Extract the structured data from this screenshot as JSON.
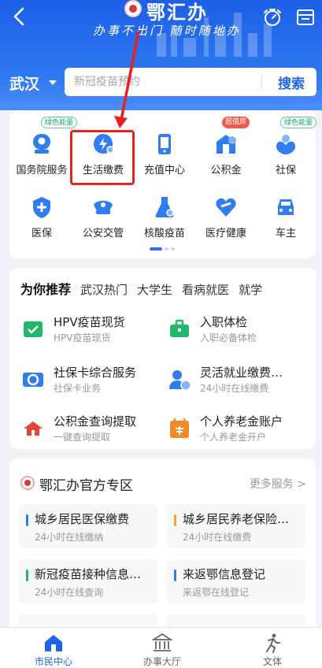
{
  "header": {
    "app_title": "鄂汇办",
    "slogan": "办事不出门 随时随地办",
    "city": "武汉",
    "search_placeholder": "新冠疫苗预约",
    "search_button": "搜索",
    "colors": {
      "primary": "#1f63e6",
      "highlight_box": "#e8211c"
    }
  },
  "services": [
    {
      "label": "国务院服务",
      "icon": "gov-service-icon",
      "tag": "绿色能量",
      "tag_style": "green"
    },
    {
      "label": "生活缴费",
      "icon": "lightning-bill-icon",
      "tag": "",
      "tag_style": ""
    },
    {
      "label": "充值中心",
      "icon": "phone-recharge-icon",
      "tag": "",
      "tag_style": ""
    },
    {
      "label": "公积金",
      "icon": "housing-fund-icon",
      "tag": "超值房",
      "tag_style": "red"
    },
    {
      "label": "社保",
      "icon": "social-security-icon",
      "tag": "绿色能量",
      "tag_style": "green"
    },
    {
      "label": "医保",
      "icon": "medical-insurance-icon"
    },
    {
      "label": "公安交管",
      "icon": "police-cap-icon"
    },
    {
      "label": "核酸疫苗",
      "icon": "flask-icon"
    },
    {
      "label": "医疗健康",
      "icon": "heart-health-icon"
    },
    {
      "label": "车主",
      "icon": "car-icon"
    }
  ],
  "recommend": {
    "tabs": [
      "为你推荐",
      "武汉热门",
      "大学生",
      "看病就医",
      "就学"
    ],
    "items": [
      {
        "title": "HPV疫苗现货",
        "sub": "HPV疫苗现货",
        "icon": "hpv-vaccine-icon",
        "color": "#22b76a"
      },
      {
        "title": "入职体检",
        "sub": "入职必备体检",
        "icon": "briefcase-icon",
        "color": "#22b76a"
      },
      {
        "title": "社保卡综合服务",
        "sub": "社保卡业务",
        "icon": "social-card-icon",
        "color": "#2f7df1"
      },
      {
        "title": "灵活就业缴费…",
        "sub": "24小时在线缴费",
        "icon": "person-yuan-icon",
        "color": "#2f7df1"
      },
      {
        "title": "公积金查询提取",
        "sub": "一键查询提取",
        "icon": "house-fund-icon",
        "color": "#e2463a"
      },
      {
        "title": "个人养老金账户",
        "sub": "个人养老金开户",
        "icon": "calendar-pension-icon",
        "color": "#f08a2a"
      }
    ]
  },
  "official": {
    "title": "鄂汇办官方专区",
    "more": "更多服务 >",
    "cards": [
      {
        "title": "城乡居民医保缴费",
        "sub": "24小时在线缴纳",
        "color": "#2f7df1"
      },
      {
        "title": "城乡居民养老保险…",
        "sub": "24小时在线缴费",
        "color": "#f0a92a"
      },
      {
        "title": "新冠疫苗接种信息…",
        "sub": "24小时在线查询",
        "color": "#22b76a"
      },
      {
        "title": "来返鄂信息登记",
        "sub": "来返鄂在线登记",
        "color": "#2f7df1"
      }
    ]
  },
  "tabbar": [
    {
      "label": "市民中心",
      "icon": "home-icon",
      "active": true
    },
    {
      "label": "办事大厅",
      "icon": "hall-building-icon",
      "active": false
    },
    {
      "label": "文体",
      "icon": "runner-icon",
      "active": false
    }
  ]
}
